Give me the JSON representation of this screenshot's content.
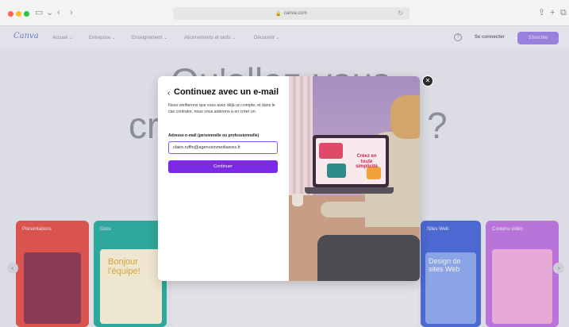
{
  "browser": {
    "url": "canva.com"
  },
  "background_page": {
    "logo": "Canva",
    "nav_items": [
      "Accueil ⌄",
      "Entreprise ⌄",
      "Enseignement ⌄",
      "Abonnements et tarifs ⌄",
      "Découvrir ⌄"
    ],
    "signin_label": "Se connecter",
    "signup_label": "S'inscrire",
    "hero_line1": "Qu'allez-vous",
    "hero_line2": "cr",
    "hero_line3": "?",
    "cards": [
      {
        "label": "Présentations",
        "text": "Bonjour l'équipe!",
        "color": "#d9534f"
      },
      {
        "label": "Docs",
        "text": "",
        "color": "#2fa79c"
      },
      {
        "label": "",
        "text": "",
        "color": "#e1e1e6"
      },
      {
        "label": "Sites Web",
        "text": "Design de sites Web",
        "color": "#4c69d1"
      },
      {
        "label": "Contenu vidéo",
        "text": "",
        "color": "#b874d8"
      }
    ]
  },
  "modal": {
    "back_icon": "chevron-left-icon",
    "title": "Continuez avec un e-mail",
    "description": "Nous vérifierons que vous avez déjà un compte, et dans le cas contraire, nous vous aiderons à en créer un.",
    "email_label": "Adresse e-mail (personnelle ou professionnelle)",
    "email_value": "claire.ruffin@agenceinmediasres.fr",
    "continue_label": "Continuer",
    "photo_screen_text": "Créez en toute simplicité",
    "close_icon": "close-icon"
  },
  "colors": {
    "accent": "#7d2ae8",
    "input_border": "#7c5cf0"
  }
}
